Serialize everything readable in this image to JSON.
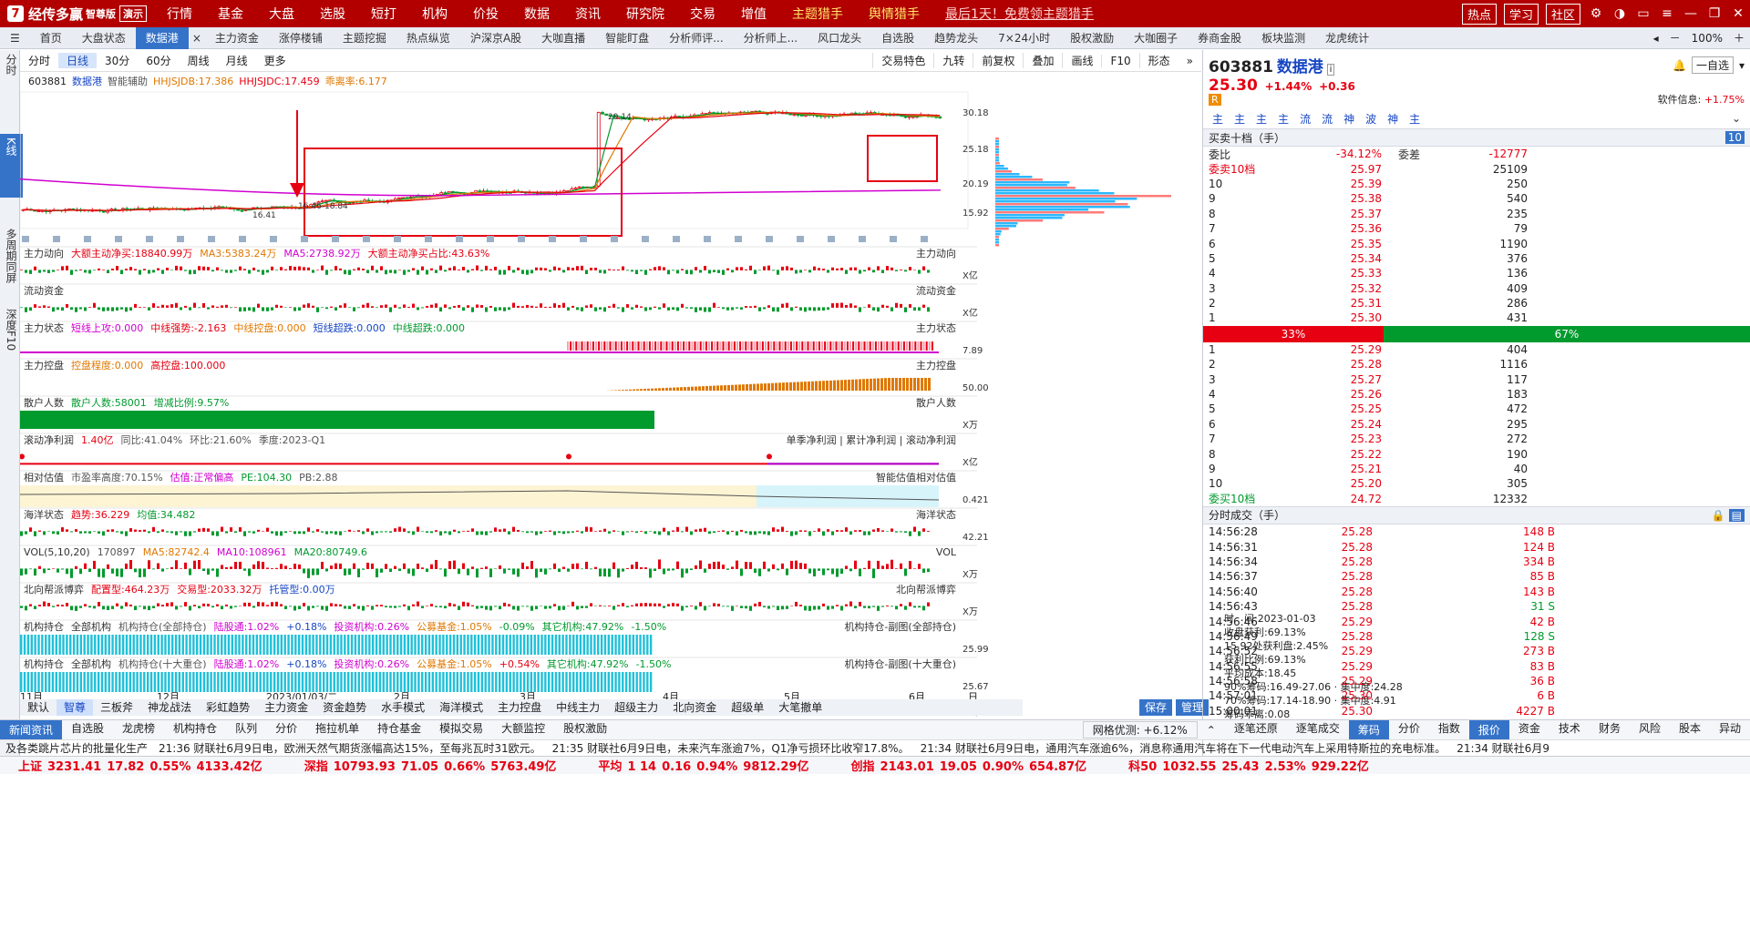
{
  "app": {
    "logo_mark": "7",
    "name": "经传多赢",
    "edition": "智尊版",
    "demo": "演示",
    "menu": [
      "行情",
      "基金",
      "大盘",
      "选股",
      "短打",
      "机构",
      "价投",
      "数据",
      "资讯",
      "研究院",
      "交易",
      "增值"
    ],
    "menu_yellow": [
      "主题猎手",
      "舆情猎手"
    ],
    "menu_promo": "最后1天！免费领主题猎手",
    "top_buttons": [
      "热点",
      "学习",
      "社区"
    ]
  },
  "tabs": [
    "首页",
    "大盘状态",
    "数据港",
    "主力资金",
    "涨停楼铺",
    "主题挖掘",
    "热点纵览",
    "沪深京A股",
    "大咖直播",
    "智能盯盘",
    "分析师评...",
    "分析师上...",
    "风口龙头",
    "自选股",
    "趋势龙头",
    "7×24小时",
    "股权激励",
    "大咖圈子",
    "券商金股",
    "板块监测",
    "龙虎统计"
  ],
  "tabs_right": {
    "zoom": "100%"
  },
  "left_side": [
    "分时",
    "K线",
    "多周期同屏",
    "深度F10"
  ],
  "chart_toolbar": {
    "left": [
      "分时",
      "日线",
      "30分",
      "60分",
      "周线",
      "月线",
      "更多"
    ],
    "right": [
      "交易特色",
      "九转",
      "前复权",
      "叠加",
      "画线",
      "F10",
      "形态"
    ]
  },
  "main_panel": {
    "code": "603881",
    "name": "数据港",
    "helper": "智能辅助",
    "ind1": "HHJSJDB:17.386",
    "ind2": "HHJSJDC:17.459",
    "ind3": "乖离率:6.177",
    "price_labels": [
      "30.18",
      "25.18",
      "20.19",
      "15.92"
    ],
    "annotations": [
      "29.14",
      "16.41",
      "16.46-18.84"
    ]
  },
  "panels": [
    {
      "title": "主力动向",
      "parts": [
        {
          "t": "大额主动净买:18840.99万",
          "c": "red"
        },
        {
          "t": "MA3:5383.24万",
          "c": "orange"
        },
        {
          "t": "MA5:2738.92万",
          "c": "magenta"
        },
        {
          "t": "大额主动净买占比:43.63%",
          "c": "red"
        }
      ],
      "right": "主力动向",
      "axis": "X亿"
    },
    {
      "title": "流动资金",
      "parts": [],
      "right": "流动资金",
      "axis": "X亿"
    },
    {
      "title": "主力状态",
      "parts": [
        {
          "t": "短线上攻:0.000",
          "c": "magenta"
        },
        {
          "t": "中线强势:-2.163",
          "c": "red"
        },
        {
          "t": "中线控盘:0.000",
          "c": "orange"
        },
        {
          "t": "短线超跌:0.000",
          "c": "blue"
        },
        {
          "t": "中线超跌:0.000",
          "c": "green"
        }
      ],
      "right": "主力状态",
      "axis": "7.89"
    },
    {
      "title": "主力控盘",
      "parts": [
        {
          "t": "控盘程度:0.000",
          "c": "orange"
        },
        {
          "t": "高控盘:100.000",
          "c": "red"
        }
      ],
      "right": "主力控盘",
      "axis": "50.00"
    },
    {
      "title": "散户人数",
      "parts": [
        {
          "t": "散户人数:58001",
          "c": "green"
        },
        {
          "t": "增减比例:9.57%",
          "c": "green"
        }
      ],
      "right": "散户人数",
      "axis": "X万"
    },
    {
      "title": "滚动净利润",
      "parts": [
        {
          "t": "1.40亿",
          "c": "red"
        },
        {
          "t": "同比:41.04%",
          "c": "gray"
        },
        {
          "t": "环比:21.60%",
          "c": "gray"
        },
        {
          "t": "季度:2023-Q1",
          "c": "gray"
        }
      ],
      "right": "单季净利润 | 累计净利润 | 滚动净利润",
      "axis": "X亿"
    },
    {
      "title": "相对估值",
      "parts": [
        {
          "t": "市盈率高度:70.15%",
          "c": "gray"
        },
        {
          "t": "估值:正常偏高",
          "c": "magenta"
        },
        {
          "t": "PE:104.30",
          "c": "green"
        },
        {
          "t": "PB:2.88",
          "c": "gray"
        }
      ],
      "right": "智能估值相对估值",
      "axis": "0.421"
    },
    {
      "title": "海洋状态",
      "parts": [
        {
          "t": "趋势:36.229",
          "c": "red"
        },
        {
          "t": "均值:34.482",
          "c": "green"
        }
      ],
      "right": "海洋状态",
      "axis": "42.21"
    },
    {
      "title": "VOL(5,10,20)",
      "parts": [
        {
          "t": "170897",
          "c": "gray"
        },
        {
          "t": "MA5:82742.4",
          "c": "orange"
        },
        {
          "t": "MA10:108961",
          "c": "magenta"
        },
        {
          "t": "MA20:80749.6",
          "c": "green"
        }
      ],
      "right": "VOL",
      "axis": "X万"
    },
    {
      "title": "北向帮派博弈",
      "parts": [
        {
          "t": "配置型:464.23万",
          "c": "red"
        },
        {
          "t": "交易型:2033.32万",
          "c": "red"
        },
        {
          "t": "托管型:0.00万",
          "c": "blue"
        }
      ],
      "right": "北向帮派博弈",
      "axis": "X万"
    },
    {
      "title": "机构持仓",
      "select": "全部机构",
      "parts": [
        {
          "t": "机构持仓(全部持仓)",
          "c": "gray"
        },
        {
          "t": "陆股通:1.02%",
          "c": "magenta"
        },
        {
          "t": "+0.18%",
          "c": "blue"
        },
        {
          "t": "投资机构:0.26%",
          "c": "magenta"
        },
        {
          "t": "公募基金:1.05%",
          "c": "orange"
        },
        {
          "t": "-0.09%",
          "c": "green"
        },
        {
          "t": "其它机构:47.92%",
          "c": "green"
        },
        {
          "t": "-1.50%",
          "c": "green"
        }
      ],
      "right": "机构持仓-副图(全部持仓)",
      "axis": "25.99"
    },
    {
      "title": "机构持仓",
      "select": "全部机构",
      "parts": [
        {
          "t": "机构持仓(十大重仓)",
          "c": "gray"
        },
        {
          "t": "陆股通:1.02%",
          "c": "magenta"
        },
        {
          "t": "+0.18%",
          "c": "blue"
        },
        {
          "t": "投资机构:0.26%",
          "c": "magenta"
        },
        {
          "t": "公募基金:1.05%",
          "c": "orange"
        },
        {
          "t": "+0.54%",
          "c": "red"
        },
        {
          "t": "其它机构:47.92%",
          "c": "green"
        },
        {
          "t": "-1.50%",
          "c": "green"
        }
      ],
      "right": "机构持仓-副图(十大重仓)",
      "axis": "25.67"
    }
  ],
  "x_axis": [
    "11月",
    "12月",
    "2023/01/03/二",
    "2月",
    "3月",
    "4月",
    "5月",
    "6月",
    "日线"
  ],
  "bottom_tabs": [
    "默认",
    "智尊",
    "三板斧",
    "神龙战法",
    "彩虹趋势",
    "主力资金",
    "资金趋势",
    "水手模式",
    "海洋模式",
    "主力控盘",
    "中线主力",
    "超级主力",
    "北向资金",
    "超级单",
    "大笔撤单"
  ],
  "bottom_tabs_right": [
    "保存",
    "管理"
  ],
  "chip": {
    "lines": [
      "时　间:2023-01-03",
      "收盘获利:69.13%",
      "15.92处获利盘:2.45%",
      "获利比例:69.13%",
      "平均成本:18.45",
      "90%筹码:16.49-27.06 · 集中度:24.28",
      "70%筹码:17.14-18.90 · 集中度:4.91",
      "筹码乖离:0.08"
    ]
  },
  "quote": {
    "code": "603881",
    "name": "数据港",
    "price": "25.30",
    "change_pct": "+1.44%",
    "change": "+0.36",
    "buttons": [
      "一自选"
    ],
    "software_info": "软件信息:",
    "software_pct": "+1.75%",
    "tags": [
      "主",
      "主",
      "主",
      "主",
      "流",
      "流",
      "神",
      "波",
      "神",
      "主"
    ],
    "book_title": "买卖十档（手）",
    "weibi_label": "委比",
    "weibi": "-34.12%",
    "weicha_label": "委差",
    "weicha": "-12777",
    "sell10_label": "委卖10档",
    "sell10_price": "25.97",
    "sell10_vol": "25109",
    "asks": [
      [
        "10",
        "25.39",
        "250"
      ],
      [
        "9",
        "25.38",
        "540"
      ],
      [
        "8",
        "25.37",
        "235"
      ],
      [
        "7",
        "25.36",
        "79"
      ],
      [
        "6",
        "25.35",
        "1190"
      ],
      [
        "5",
        "25.34",
        "376"
      ],
      [
        "4",
        "25.33",
        "136"
      ],
      [
        "3",
        "25.32",
        "409"
      ],
      [
        "2",
        "25.31",
        "286"
      ],
      [
        "1",
        "25.30",
        "431"
      ]
    ],
    "bar_red": "33%",
    "bar_green": "67%",
    "bids": [
      [
        "1",
        "25.29",
        "404"
      ],
      [
        "2",
        "25.28",
        "1116"
      ],
      [
        "3",
        "25.27",
        "117"
      ],
      [
        "4",
        "25.26",
        "183"
      ],
      [
        "5",
        "25.25",
        "472"
      ],
      [
        "6",
        "25.24",
        "295"
      ],
      [
        "7",
        "25.23",
        "272"
      ],
      [
        "8",
        "25.22",
        "190"
      ],
      [
        "9",
        "25.21",
        "40"
      ],
      [
        "10",
        "25.20",
        "305"
      ]
    ],
    "buy10_label": "委买10档",
    "buy10_price": "24.72",
    "buy10_vol": "12332",
    "ticks_title": "分时成交（手）",
    "ticks": [
      [
        "14:56:28",
        "25.28",
        "148 B"
      ],
      [
        "14:56:31",
        "25.28",
        "124 B"
      ],
      [
        "14:56:34",
        "25.28",
        "334 B"
      ],
      [
        "14:56:37",
        "25.28",
        "85 B"
      ],
      [
        "14:56:40",
        "25.28",
        "143 B"
      ],
      [
        "14:56:43",
        "25.28",
        "31 S"
      ],
      [
        "14:56:46",
        "25.29",
        "42 B"
      ],
      [
        "14:56:49",
        "25.28",
        "128 S"
      ],
      [
        "14:56:52",
        "25.29",
        "273 B"
      ],
      [
        "14:56:55",
        "25.29",
        "83 B"
      ],
      [
        "14:56:58",
        "25.29",
        "36 B"
      ],
      [
        "14:57:01",
        "25.30",
        "6 B"
      ],
      [
        "15:00:01",
        "25.30",
        "4227 B"
      ]
    ]
  },
  "news_bar": {
    "left": [
      "新闻资讯",
      "自选股",
      "龙虎榜",
      "机构持仓",
      "队列",
      "分价",
      "拖拉机单",
      "持仓基金",
      "模拟交易",
      "大额监控",
      "股权激励"
    ],
    "mid": "网格优测: +6.12%",
    "right": [
      "逐笔还原",
      "逐笔成交",
      "筹码",
      "分价",
      "指数",
      "报价",
      "资金",
      "技术",
      "财务",
      "风险",
      "股本",
      "异动"
    ]
  },
  "ticker": [
    "及各类跳片芯片的批量化生产",
    "21:36 财联社6月9日电，欧洲天然气期货涨幅高达15%，至每兆瓦时31欧元。",
    "21:35 财联社6月9日电，未来汽车涨逾7%，Q1净亏损环比收窄17.8%。",
    "21:34 财联社6月9日电，通用汽车涨逾6%，消息称通用汽车将在下一代电动汽车上采用特斯拉的充电标准。",
    "21:34 财联社6月9"
  ],
  "indices": [
    {
      "name": "上证",
      "v": "3231.41",
      "c": "17.82",
      "p": "0.55%",
      "a": "4133.42亿"
    },
    {
      "name": "深指",
      "v": "10793.93",
      "c": "71.05",
      "p": "0.66%",
      "a": "5763.49亿"
    },
    {
      "name": "平均",
      "v": "1  14",
      "c": "0.16",
      "p": "0.94%",
      "a": "9812.29亿"
    },
    {
      "name": "创指",
      "v": "2143.01",
      "c": "19.05",
      "p": "0.90%",
      "a": "654.87亿"
    },
    {
      "name": "科50",
      "v": "1032.55",
      "c": "25.43",
      "p": "2.53%",
      "a": "929.22亿"
    }
  ],
  "colors": {
    "red": "#e60012",
    "green": "#009a2d",
    "blue": "#1746c4",
    "brand": "#b20000"
  }
}
